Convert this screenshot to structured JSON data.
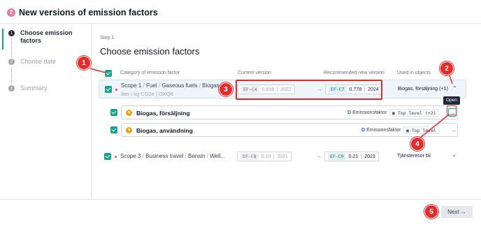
{
  "header": {
    "step_number": "2",
    "title": "New versions of emission factors"
  },
  "sidebar": {
    "items": [
      {
        "number": "1",
        "label": "Choose emission factors"
      },
      {
        "number": "2",
        "label": "Choose date"
      },
      {
        "number": "3",
        "label": "Summary"
      }
    ]
  },
  "main": {
    "step_label": "Step 1",
    "title": "Choose emission factors",
    "columns": {
      "category": "Category of emission factor",
      "current": "Current version",
      "recommended": "Recommended new version",
      "used": "Used in objects"
    },
    "rows": [
      {
        "path": [
          "Scope 1",
          "Fuel",
          "Gaseous fuels",
          "Biogas"
        ],
        "path_separator": "/",
        "unit_line": "liter  |  kg CO2e  |  OKQ8",
        "current_code": "EF-C4",
        "current_value": "0.656",
        "current_year": "2022",
        "new_code": "EF-C7",
        "new_value": "0.778",
        "new_year": "2024",
        "used_in": "Biogas, försäljning (+1)",
        "expand_icon": "chevron-up"
      },
      {
        "path": [
          "Scope 3",
          "Business travel",
          "Bensin",
          "Well..."
        ],
        "path_separator": "/",
        "current_code": "EF-C8",
        "current_value": "0.19",
        "current_year": "2021",
        "new_code": "EF-C9",
        "new_value": "0.21",
        "new_year": "2023",
        "used_in": "Tjänsteresor bil",
        "expand_icon": "chevron-down"
      }
    ],
    "objects": [
      {
        "name": "Biogas, försäljning",
        "ef_prefix": "D",
        "ef_label": "Emissionsfaktor",
        "level": "Top level (+2)"
      },
      {
        "name": "Biogas, användning",
        "ef_prefix": "D",
        "ef_label": "Emissionsfaktor",
        "level": "Top level"
      }
    ],
    "tooltip": "Open",
    "arrow_glyph": "→"
  },
  "footer": {
    "next_label": "Next →"
  },
  "callouts": [
    "1",
    "2",
    "3",
    "4",
    "5"
  ],
  "colors": {
    "accent": "#14a38b",
    "callout": "#e32d2d",
    "step_badge": "#e879a8"
  }
}
